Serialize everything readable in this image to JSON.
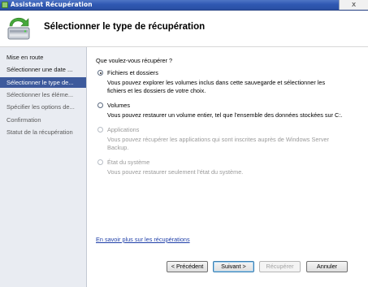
{
  "window": {
    "title": "Assistant Récupération",
    "close_glyph": "x"
  },
  "header": {
    "heading": "Sélectionner le type de récupération",
    "icon": "backup-wizard-icon"
  },
  "sidebar": {
    "steps": [
      {
        "label": "Mise en route",
        "state": "normal"
      },
      {
        "label": "Sélectionner une date ...",
        "state": "normal"
      },
      {
        "label": "Sélectionner le type de...",
        "state": "active"
      },
      {
        "label": "Sélectionner les éléme...",
        "state": "disabled"
      },
      {
        "label": "Spécifier les options de...",
        "state": "disabled"
      },
      {
        "label": "Confirmation",
        "state": "disabled"
      },
      {
        "label": "Statut de la récupération",
        "state": "disabled"
      }
    ]
  },
  "content": {
    "question": "Que voulez-vous récupérer ?",
    "options": [
      {
        "label": "Fichiers et dossiers",
        "desc_line1": "Vous pouvez explorer les volumes inclus dans cette sauvegarde et sélectionner les",
        "desc_line2": "fichiers et les dossiers de votre choix.",
        "checked": true,
        "enabled": true
      },
      {
        "label": "Volumes",
        "desc_line1": "Vous pouvez restaurer un volume entier, tel que l'ensemble des données stockées sur C:.",
        "desc_line2": "",
        "checked": false,
        "enabled": true
      },
      {
        "label": "Applications",
        "desc_line1": "Vous pouvez récupérer les applications qui sont inscrites auprès de Windows Server",
        "desc_line2": "Backup.",
        "checked": false,
        "enabled": false
      },
      {
        "label": "État du système",
        "desc_line1": "Vous pouvez restaurer seulement l'état du système.",
        "desc_line2": "",
        "checked": false,
        "enabled": false
      }
    ],
    "learn_more_link": "En savoir plus sur les récupérations"
  },
  "buttons": {
    "previous": "< Précédent",
    "next": "Suivant >",
    "recover": "Récupérer",
    "cancel": "Annuler"
  },
  "colors": {
    "titlebar": "#2f58b2",
    "sidebar_bg": "#e9ecf2",
    "active_step": "#3d5a9c",
    "link": "#1f3fa8"
  }
}
